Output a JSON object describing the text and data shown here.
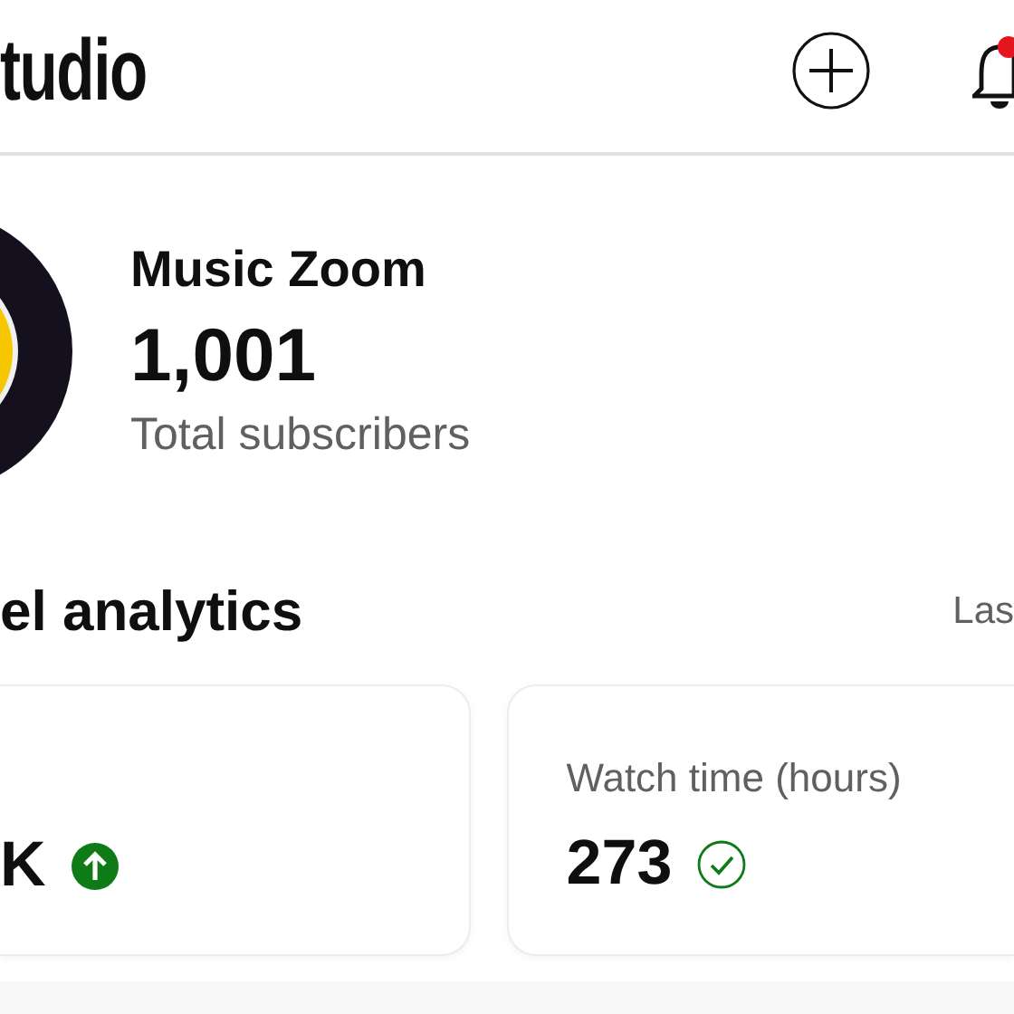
{
  "header": {
    "logo_text": "tudio"
  },
  "channel": {
    "name": "Music Zoom",
    "subscribers": "1,001",
    "subscribers_label": "Total subscribers"
  },
  "analytics": {
    "title": "el analytics",
    "period": "Las",
    "cards": [
      {
        "value": "K",
        "kind": "up"
      },
      {
        "label": "Watch time (hours)",
        "value": "273",
        "kind": "met"
      }
    ]
  }
}
